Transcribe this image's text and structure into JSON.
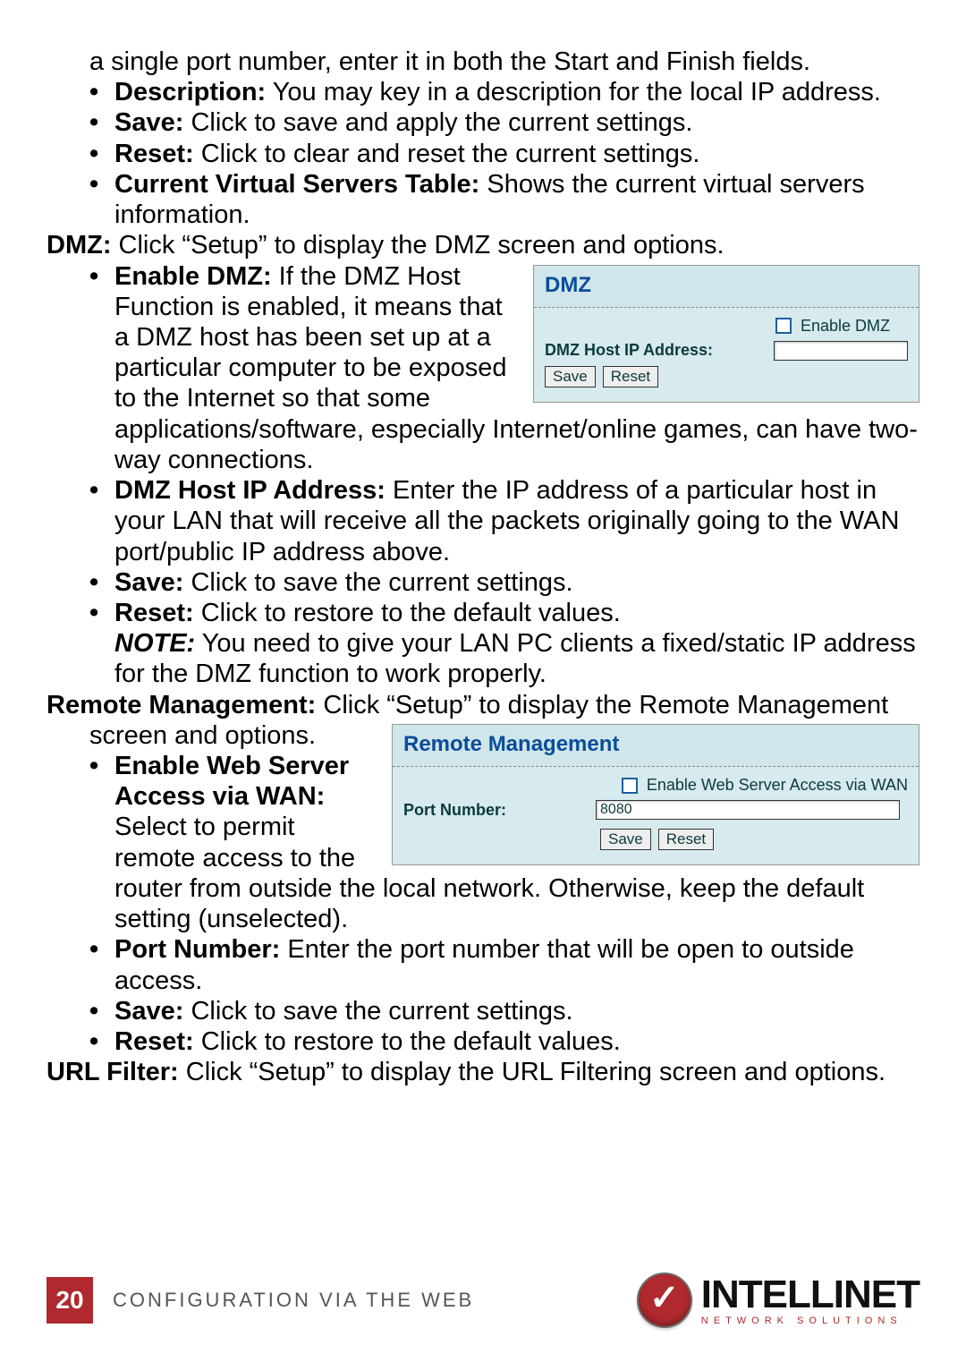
{
  "intro_continuation": "a single port number, enter it in both the Start and Finish fields.",
  "top_bullets": [
    {
      "label": "Description:",
      "text": " You may key in a description for the local IP address."
    },
    {
      "label": "Save:",
      "text": " Click to save and apply the current settings."
    },
    {
      "label": "Reset:",
      "text": " Click to clear and reset the current settings."
    },
    {
      "label": "Current Virtual Servers Table:",
      "text": " Shows the current virtual servers information."
    }
  ],
  "dmz_intro_label": "DMZ:",
  "dmz_intro_text": " Click “Setup” to display the DMZ screen and options.",
  "dmz_bullets": [
    {
      "label": "Enable DMZ:",
      "text": " If the DMZ Host Function is enabled, it means that a DMZ host has been set up at a particular computer to be exposed to the Internet so that some applications/software, especially Internet/online games, can have two-way connections."
    },
    {
      "label": "DMZ Host IP Address:",
      "text": " Enter the IP address of a particular host in your LAN that will receive all the packets originally going to the WAN port/public IP address above."
    },
    {
      "label": "Save:",
      "text": " Click to save the current settings."
    },
    {
      "label": "Reset:",
      "text": " Click to restore to the default values."
    }
  ],
  "dmz_note_label": "NOTE:",
  "dmz_note_text": " You need to give your LAN PC clients a fixed/static IP address for the DMZ function to work properly.",
  "remote_intro_label": "Remote Management:",
  "remote_intro_text_a": " Click “Setup” to display the Remote Management ",
  "remote_intro_text_b": "screen and options.",
  "remote_bullets": [
    {
      "label": "Enable Web Server Access via WAN:",
      "text": " Select to permit remote access to the router from outside the local network. Otherwise, keep the default setting (unselected)."
    },
    {
      "label": "Port Number:",
      "text": " Enter the port number that will be open to outside access."
    },
    {
      "label": "Save:",
      "text": " Click to save the current settings."
    },
    {
      "label": "Reset:",
      "text": " Click to restore to the default values."
    }
  ],
  "url_filter_label": "URL Filter:",
  "url_filter_text": " Click “Setup” to display the URL Filtering screen and options.",
  "dmz_panel": {
    "title": "DMZ",
    "enable_label": "Enable DMZ",
    "host_label": "DMZ Host IP Address:",
    "host_value": "",
    "save": "Save",
    "reset": "Reset"
  },
  "remote_panel": {
    "title": "Remote Management",
    "enable_label": "Enable Web Server Access via WAN",
    "port_label": "Port Number:",
    "port_value": "8080",
    "save": "Save",
    "reset": "Reset"
  },
  "footer": {
    "page_number": "20",
    "caption": "CONFIGURATION VIA THE WEB",
    "brand_name": "INTELLINET",
    "brand_sub": "NETWORK SOLUTIONS"
  }
}
